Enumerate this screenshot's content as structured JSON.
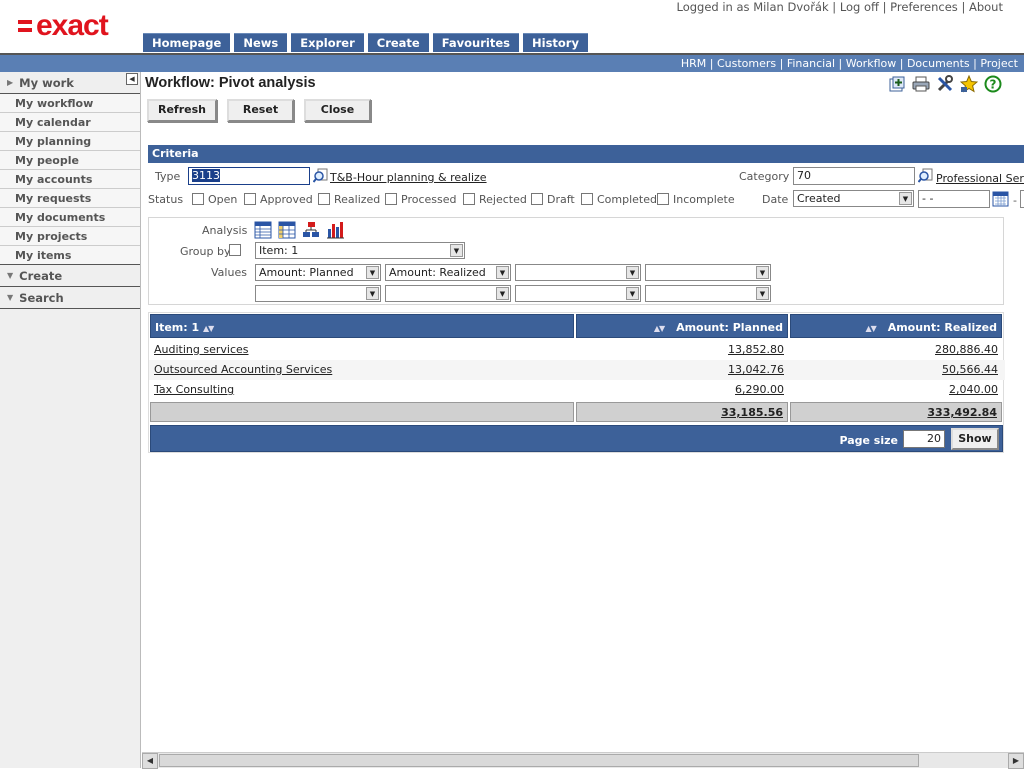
{
  "brand": {
    "logo_text": "exact"
  },
  "user_links": {
    "logged_in": "Logged in as Milan Dvořák",
    "logoff": "Log off",
    "preferences": "Preferences",
    "about": "About"
  },
  "main_tabs": [
    "Homepage",
    "News",
    "Explorer",
    "Create",
    "Favourites",
    "History"
  ],
  "sub_nav": [
    "HRM",
    "Customers",
    "Financial",
    "Workflow",
    "Documents",
    "Project"
  ],
  "sidebar": {
    "my_work": "My work",
    "items": [
      "My workflow",
      "My calendar",
      "My planning",
      "My people",
      "My accounts",
      "My requests",
      "My documents",
      "My projects",
      "My items"
    ],
    "create": "Create",
    "search": "Search"
  },
  "page": {
    "title": "Workflow: Pivot analysis"
  },
  "buttons": {
    "refresh": "Refresh",
    "reset": "Reset",
    "close": "Close"
  },
  "criteria": {
    "header": "Criteria",
    "type_label": "Type",
    "type_value": "3113",
    "type_link": "T&B-Hour planning & realize",
    "category_label": "Category",
    "category_value": "70",
    "category_link": "Professional Services",
    "status_label": "Status",
    "statuses": [
      "Open",
      "Approved",
      "Realized",
      "Processed",
      "Rejected",
      "Draft",
      "Completed",
      "Incomplete"
    ],
    "date_label": "Date",
    "date_select": "Created",
    "date_from": "- -",
    "date_dash": "-"
  },
  "analysis": {
    "analysis_label": "Analysis",
    "groupby_label": "Group by",
    "groupby_value": "Item: 1",
    "values_label": "Values",
    "values_row1": [
      "Amount: Planned",
      "Amount: Realized",
      "",
      ""
    ],
    "values_row2": [
      "",
      "",
      "",
      ""
    ]
  },
  "results": {
    "columns": [
      "Item: 1",
      "Amount: Planned",
      "Amount: Realized"
    ],
    "rows": [
      {
        "item": "Auditing services",
        "planned": "13,852.80",
        "realized": "280,886.40"
      },
      {
        "item": "Outsourced Accounting Services",
        "planned": "13,042.76",
        "realized": "50,566.44"
      },
      {
        "item": "Tax Consulting",
        "planned": "6,290.00",
        "realized": "2,040.00"
      }
    ],
    "totals": {
      "planned": "33,185.56",
      "realized": "333,492.84"
    },
    "page_size_label": "Page size",
    "page_size_value": "20",
    "show_button": "Show"
  },
  "colors": {
    "brand_red": "#e0141e",
    "header_blue": "#3d6199",
    "subnav_blue": "#5a7fb4"
  }
}
